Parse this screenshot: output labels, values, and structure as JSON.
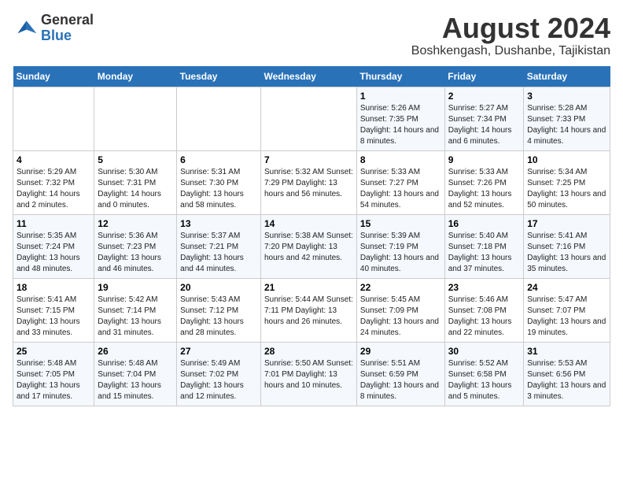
{
  "logo": {
    "line1": "General",
    "line2": "Blue"
  },
  "title": "August 2024",
  "subtitle": "Boshkengash, Dushanbe, Tajikistan",
  "weekdays": [
    "Sunday",
    "Monday",
    "Tuesday",
    "Wednesday",
    "Thursday",
    "Friday",
    "Saturday"
  ],
  "weeks": [
    [
      {
        "day": "",
        "info": ""
      },
      {
        "day": "",
        "info": ""
      },
      {
        "day": "",
        "info": ""
      },
      {
        "day": "",
        "info": ""
      },
      {
        "day": "1",
        "info": "Sunrise: 5:26 AM\nSunset: 7:35 PM\nDaylight: 14 hours\nand 8 minutes."
      },
      {
        "day": "2",
        "info": "Sunrise: 5:27 AM\nSunset: 7:34 PM\nDaylight: 14 hours\nand 6 minutes."
      },
      {
        "day": "3",
        "info": "Sunrise: 5:28 AM\nSunset: 7:33 PM\nDaylight: 14 hours\nand 4 minutes."
      }
    ],
    [
      {
        "day": "4",
        "info": "Sunrise: 5:29 AM\nSunset: 7:32 PM\nDaylight: 14 hours\nand 2 minutes."
      },
      {
        "day": "5",
        "info": "Sunrise: 5:30 AM\nSunset: 7:31 PM\nDaylight: 14 hours\nand 0 minutes."
      },
      {
        "day": "6",
        "info": "Sunrise: 5:31 AM\nSunset: 7:30 PM\nDaylight: 13 hours\nand 58 minutes."
      },
      {
        "day": "7",
        "info": "Sunrise: 5:32 AM\nSunset: 7:29 PM\nDaylight: 13 hours\nand 56 minutes."
      },
      {
        "day": "8",
        "info": "Sunrise: 5:33 AM\nSunset: 7:27 PM\nDaylight: 13 hours\nand 54 minutes."
      },
      {
        "day": "9",
        "info": "Sunrise: 5:33 AM\nSunset: 7:26 PM\nDaylight: 13 hours\nand 52 minutes."
      },
      {
        "day": "10",
        "info": "Sunrise: 5:34 AM\nSunset: 7:25 PM\nDaylight: 13 hours\nand 50 minutes."
      }
    ],
    [
      {
        "day": "11",
        "info": "Sunrise: 5:35 AM\nSunset: 7:24 PM\nDaylight: 13 hours\nand 48 minutes."
      },
      {
        "day": "12",
        "info": "Sunrise: 5:36 AM\nSunset: 7:23 PM\nDaylight: 13 hours\nand 46 minutes."
      },
      {
        "day": "13",
        "info": "Sunrise: 5:37 AM\nSunset: 7:21 PM\nDaylight: 13 hours\nand 44 minutes."
      },
      {
        "day": "14",
        "info": "Sunrise: 5:38 AM\nSunset: 7:20 PM\nDaylight: 13 hours\nand 42 minutes."
      },
      {
        "day": "15",
        "info": "Sunrise: 5:39 AM\nSunset: 7:19 PM\nDaylight: 13 hours\nand 40 minutes."
      },
      {
        "day": "16",
        "info": "Sunrise: 5:40 AM\nSunset: 7:18 PM\nDaylight: 13 hours\nand 37 minutes."
      },
      {
        "day": "17",
        "info": "Sunrise: 5:41 AM\nSunset: 7:16 PM\nDaylight: 13 hours\nand 35 minutes."
      }
    ],
    [
      {
        "day": "18",
        "info": "Sunrise: 5:41 AM\nSunset: 7:15 PM\nDaylight: 13 hours\nand 33 minutes."
      },
      {
        "day": "19",
        "info": "Sunrise: 5:42 AM\nSunset: 7:14 PM\nDaylight: 13 hours\nand 31 minutes."
      },
      {
        "day": "20",
        "info": "Sunrise: 5:43 AM\nSunset: 7:12 PM\nDaylight: 13 hours\nand 28 minutes."
      },
      {
        "day": "21",
        "info": "Sunrise: 5:44 AM\nSunset: 7:11 PM\nDaylight: 13 hours\nand 26 minutes."
      },
      {
        "day": "22",
        "info": "Sunrise: 5:45 AM\nSunset: 7:09 PM\nDaylight: 13 hours\nand 24 minutes."
      },
      {
        "day": "23",
        "info": "Sunrise: 5:46 AM\nSunset: 7:08 PM\nDaylight: 13 hours\nand 22 minutes."
      },
      {
        "day": "24",
        "info": "Sunrise: 5:47 AM\nSunset: 7:07 PM\nDaylight: 13 hours\nand 19 minutes."
      }
    ],
    [
      {
        "day": "25",
        "info": "Sunrise: 5:48 AM\nSunset: 7:05 PM\nDaylight: 13 hours\nand 17 minutes."
      },
      {
        "day": "26",
        "info": "Sunrise: 5:48 AM\nSunset: 7:04 PM\nDaylight: 13 hours\nand 15 minutes."
      },
      {
        "day": "27",
        "info": "Sunrise: 5:49 AM\nSunset: 7:02 PM\nDaylight: 13 hours\nand 12 minutes."
      },
      {
        "day": "28",
        "info": "Sunrise: 5:50 AM\nSunset: 7:01 PM\nDaylight: 13 hours\nand 10 minutes."
      },
      {
        "day": "29",
        "info": "Sunrise: 5:51 AM\nSunset: 6:59 PM\nDaylight: 13 hours\nand 8 minutes."
      },
      {
        "day": "30",
        "info": "Sunrise: 5:52 AM\nSunset: 6:58 PM\nDaylight: 13 hours\nand 5 minutes."
      },
      {
        "day": "31",
        "info": "Sunrise: 5:53 AM\nSunset: 6:56 PM\nDaylight: 13 hours\nand 3 minutes."
      }
    ]
  ]
}
